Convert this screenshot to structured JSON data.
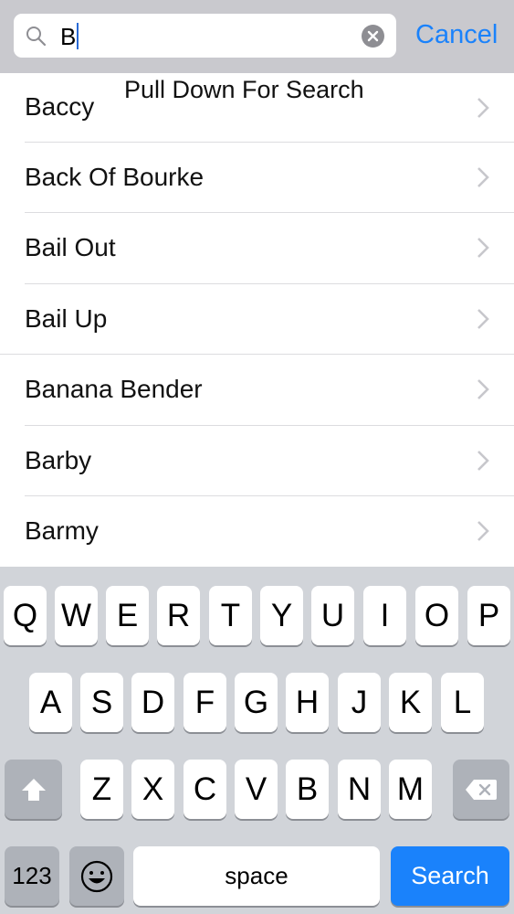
{
  "search": {
    "value": "B",
    "cancel_label": "Cancel"
  },
  "overlay_text": "Pull Down For Search",
  "results": [
    {
      "label": "Baccy"
    },
    {
      "label": "Back Of Bourke"
    },
    {
      "label": "Bail Out"
    },
    {
      "label": "Bail Up"
    },
    {
      "label": "Banana Bender"
    },
    {
      "label": "Barby"
    },
    {
      "label": "Barmy"
    }
  ],
  "keyboard": {
    "row1": [
      "Q",
      "W",
      "E",
      "R",
      "T",
      "Y",
      "U",
      "I",
      "O",
      "P"
    ],
    "row2": [
      "A",
      "S",
      "D",
      "F",
      "G",
      "H",
      "J",
      "K",
      "L"
    ],
    "row3": [
      "Z",
      "X",
      "C",
      "V",
      "B",
      "N",
      "M"
    ],
    "numbers_label": "123",
    "space_label": "space",
    "search_label": "Search",
    "icons": {
      "shift": "shift-icon",
      "delete": "backspace-icon",
      "emoji": "emoji-icon"
    }
  },
  "colors": {
    "accent": "#1a82fb",
    "search_bar_bg": "#c9c9ce",
    "keyboard_bg": "#d1d4d9"
  }
}
